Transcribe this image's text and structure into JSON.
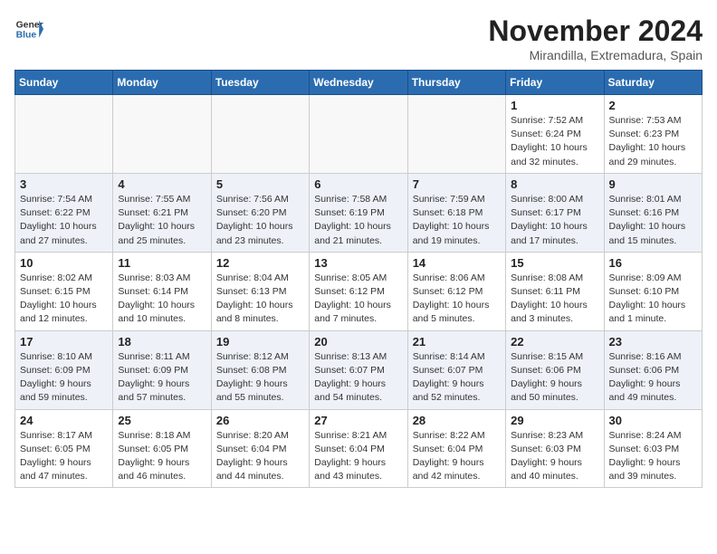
{
  "header": {
    "logo_general": "General",
    "logo_blue": "Blue",
    "month_title": "November 2024",
    "subtitle": "Mirandilla, Extremadura, Spain"
  },
  "days_of_week": [
    "Sunday",
    "Monday",
    "Tuesday",
    "Wednesday",
    "Thursday",
    "Friday",
    "Saturday"
  ],
  "weeks": [
    [
      {
        "day": "",
        "info": ""
      },
      {
        "day": "",
        "info": ""
      },
      {
        "day": "",
        "info": ""
      },
      {
        "day": "",
        "info": ""
      },
      {
        "day": "",
        "info": ""
      },
      {
        "day": "1",
        "info": "Sunrise: 7:52 AM\nSunset: 6:24 PM\nDaylight: 10 hours and 32 minutes."
      },
      {
        "day": "2",
        "info": "Sunrise: 7:53 AM\nSunset: 6:23 PM\nDaylight: 10 hours and 29 minutes."
      }
    ],
    [
      {
        "day": "3",
        "info": "Sunrise: 7:54 AM\nSunset: 6:22 PM\nDaylight: 10 hours and 27 minutes."
      },
      {
        "day": "4",
        "info": "Sunrise: 7:55 AM\nSunset: 6:21 PM\nDaylight: 10 hours and 25 minutes."
      },
      {
        "day": "5",
        "info": "Sunrise: 7:56 AM\nSunset: 6:20 PM\nDaylight: 10 hours and 23 minutes."
      },
      {
        "day": "6",
        "info": "Sunrise: 7:58 AM\nSunset: 6:19 PM\nDaylight: 10 hours and 21 minutes."
      },
      {
        "day": "7",
        "info": "Sunrise: 7:59 AM\nSunset: 6:18 PM\nDaylight: 10 hours and 19 minutes."
      },
      {
        "day": "8",
        "info": "Sunrise: 8:00 AM\nSunset: 6:17 PM\nDaylight: 10 hours and 17 minutes."
      },
      {
        "day": "9",
        "info": "Sunrise: 8:01 AM\nSunset: 6:16 PM\nDaylight: 10 hours and 15 minutes."
      }
    ],
    [
      {
        "day": "10",
        "info": "Sunrise: 8:02 AM\nSunset: 6:15 PM\nDaylight: 10 hours and 12 minutes."
      },
      {
        "day": "11",
        "info": "Sunrise: 8:03 AM\nSunset: 6:14 PM\nDaylight: 10 hours and 10 minutes."
      },
      {
        "day": "12",
        "info": "Sunrise: 8:04 AM\nSunset: 6:13 PM\nDaylight: 10 hours and 8 minutes."
      },
      {
        "day": "13",
        "info": "Sunrise: 8:05 AM\nSunset: 6:12 PM\nDaylight: 10 hours and 7 minutes."
      },
      {
        "day": "14",
        "info": "Sunrise: 8:06 AM\nSunset: 6:12 PM\nDaylight: 10 hours and 5 minutes."
      },
      {
        "day": "15",
        "info": "Sunrise: 8:08 AM\nSunset: 6:11 PM\nDaylight: 10 hours and 3 minutes."
      },
      {
        "day": "16",
        "info": "Sunrise: 8:09 AM\nSunset: 6:10 PM\nDaylight: 10 hours and 1 minute."
      }
    ],
    [
      {
        "day": "17",
        "info": "Sunrise: 8:10 AM\nSunset: 6:09 PM\nDaylight: 9 hours and 59 minutes."
      },
      {
        "day": "18",
        "info": "Sunrise: 8:11 AM\nSunset: 6:09 PM\nDaylight: 9 hours and 57 minutes."
      },
      {
        "day": "19",
        "info": "Sunrise: 8:12 AM\nSunset: 6:08 PM\nDaylight: 9 hours and 55 minutes."
      },
      {
        "day": "20",
        "info": "Sunrise: 8:13 AM\nSunset: 6:07 PM\nDaylight: 9 hours and 54 minutes."
      },
      {
        "day": "21",
        "info": "Sunrise: 8:14 AM\nSunset: 6:07 PM\nDaylight: 9 hours and 52 minutes."
      },
      {
        "day": "22",
        "info": "Sunrise: 8:15 AM\nSunset: 6:06 PM\nDaylight: 9 hours and 50 minutes."
      },
      {
        "day": "23",
        "info": "Sunrise: 8:16 AM\nSunset: 6:06 PM\nDaylight: 9 hours and 49 minutes."
      }
    ],
    [
      {
        "day": "24",
        "info": "Sunrise: 8:17 AM\nSunset: 6:05 PM\nDaylight: 9 hours and 47 minutes."
      },
      {
        "day": "25",
        "info": "Sunrise: 8:18 AM\nSunset: 6:05 PM\nDaylight: 9 hours and 46 minutes."
      },
      {
        "day": "26",
        "info": "Sunrise: 8:20 AM\nSunset: 6:04 PM\nDaylight: 9 hours and 44 minutes."
      },
      {
        "day": "27",
        "info": "Sunrise: 8:21 AM\nSunset: 6:04 PM\nDaylight: 9 hours and 43 minutes."
      },
      {
        "day": "28",
        "info": "Sunrise: 8:22 AM\nSunset: 6:04 PM\nDaylight: 9 hours and 42 minutes."
      },
      {
        "day": "29",
        "info": "Sunrise: 8:23 AM\nSunset: 6:03 PM\nDaylight: 9 hours and 40 minutes."
      },
      {
        "day": "30",
        "info": "Sunrise: 8:24 AM\nSunset: 6:03 PM\nDaylight: 9 hours and 39 minutes."
      }
    ]
  ]
}
